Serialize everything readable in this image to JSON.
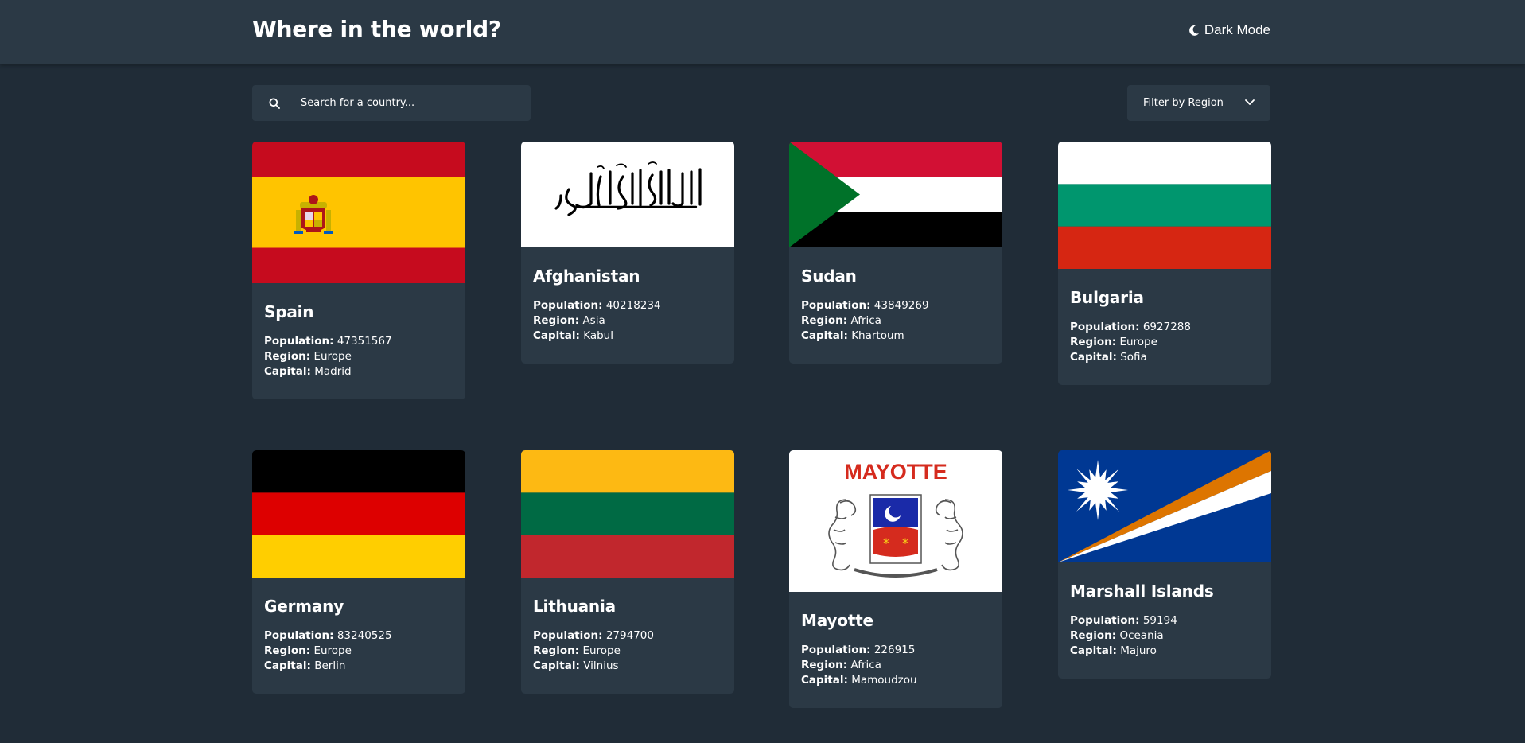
{
  "header": {
    "title": "Where in the world?",
    "dark_mode_label": "Dark Mode"
  },
  "search": {
    "placeholder": "Search for a country..."
  },
  "filter": {
    "label": "Filter by Region"
  },
  "labels": {
    "population": "Population:",
    "region": "Region:",
    "capital": "Capital:"
  },
  "countries": [
    {
      "name": "Spain",
      "population": "47351567",
      "region": "Europe",
      "capital": "Madrid"
    },
    {
      "name": "Afghanistan",
      "population": "40218234",
      "region": "Asia",
      "capital": "Kabul"
    },
    {
      "name": "Sudan",
      "population": "43849269",
      "region": "Africa",
      "capital": "Khartoum"
    },
    {
      "name": "Bulgaria",
      "population": "6927288",
      "region": "Europe",
      "capital": "Sofia"
    },
    {
      "name": "Germany",
      "population": "83240525",
      "region": "Europe",
      "capital": "Berlin"
    },
    {
      "name": "Lithuania",
      "population": "2794700",
      "region": "Europe",
      "capital": "Vilnius"
    },
    {
      "name": "Mayotte",
      "population": "226915",
      "region": "Africa",
      "capital": "Mamoudzou",
      "flag_text": "MAYOTTE"
    },
    {
      "name": "Marshall Islands",
      "population": "59194",
      "region": "Oceania",
      "capital": "Majuro"
    }
  ],
  "colors": {
    "background": "#202c37",
    "element": "#2b3945",
    "text": "#ffffff"
  }
}
